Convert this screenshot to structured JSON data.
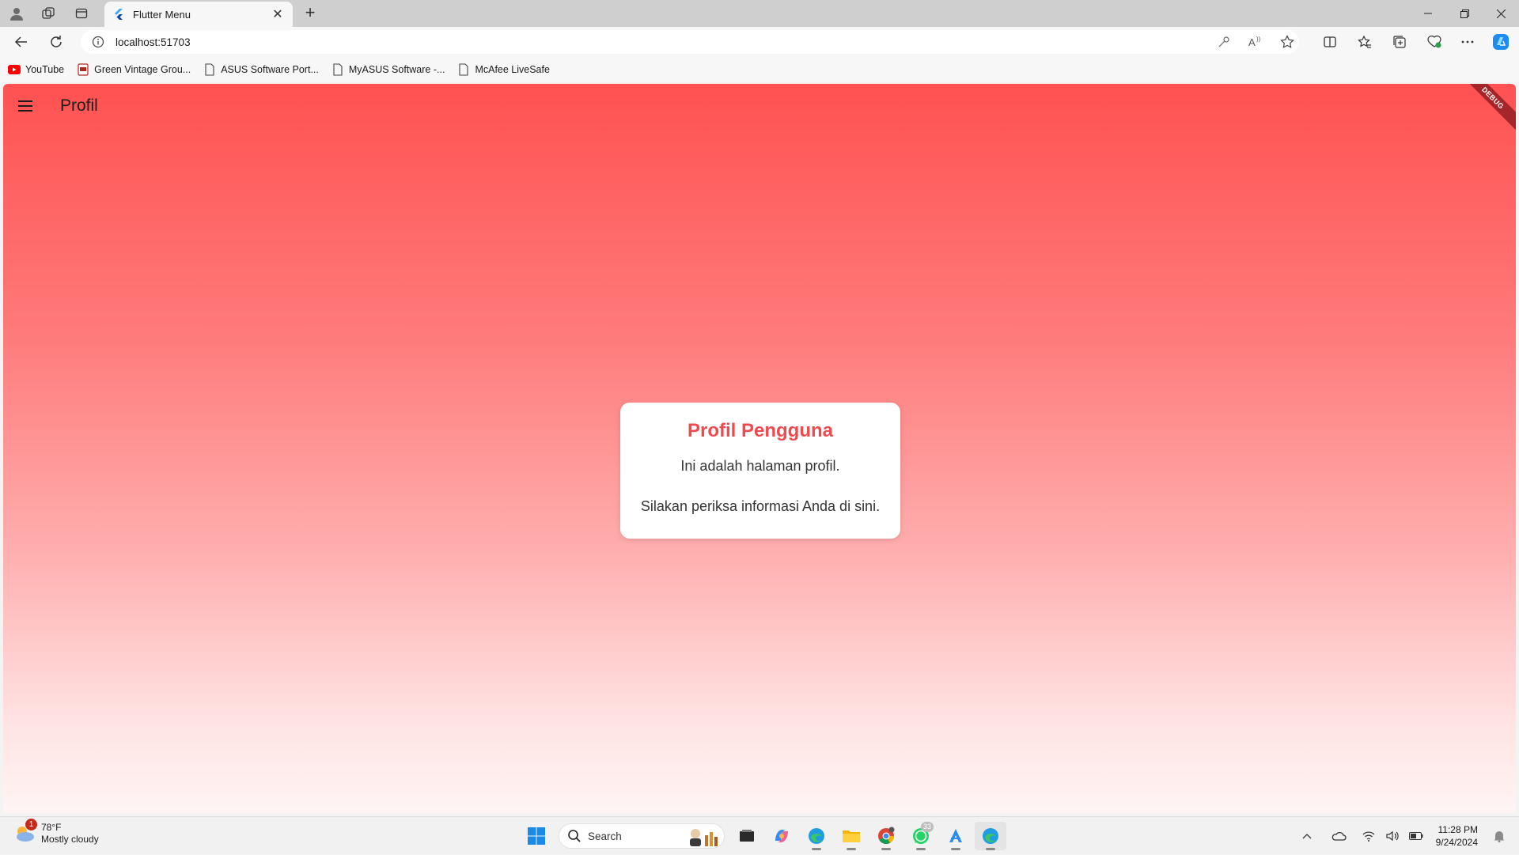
{
  "browser": {
    "tab_title": "Flutter Menu",
    "url": "localhost:51703",
    "bookmarks": [
      {
        "label": "YouTube",
        "icon": "youtube-icon"
      },
      {
        "label": "Green Vintage Grou...",
        "icon": "pdf-icon"
      },
      {
        "label": "ASUS Software Port...",
        "icon": "page-icon"
      },
      {
        "label": "MyASUS Software -...",
        "icon": "page-icon"
      },
      {
        "label": "McAfee LiveSafe",
        "icon": "page-icon"
      }
    ]
  },
  "app": {
    "title": "Profil",
    "debug_banner": "DEBUG",
    "card": {
      "heading": "Profil Pengguna",
      "line1": "Ini adalah halaman profil.",
      "line2": "Silakan periksa informasi Anda di sini."
    },
    "colors": {
      "gradient_top": "#ff5151",
      "gradient_bottom": "#fff4f4",
      "heading": "#ef4a4f"
    }
  },
  "taskbar": {
    "weather_temp": "78°F",
    "weather_desc": "Mostly cloudy",
    "weather_badge": "1",
    "search_placeholder": "Search",
    "whatsapp_badge": "33",
    "time": "11:28 PM",
    "date": "9/24/2024"
  }
}
